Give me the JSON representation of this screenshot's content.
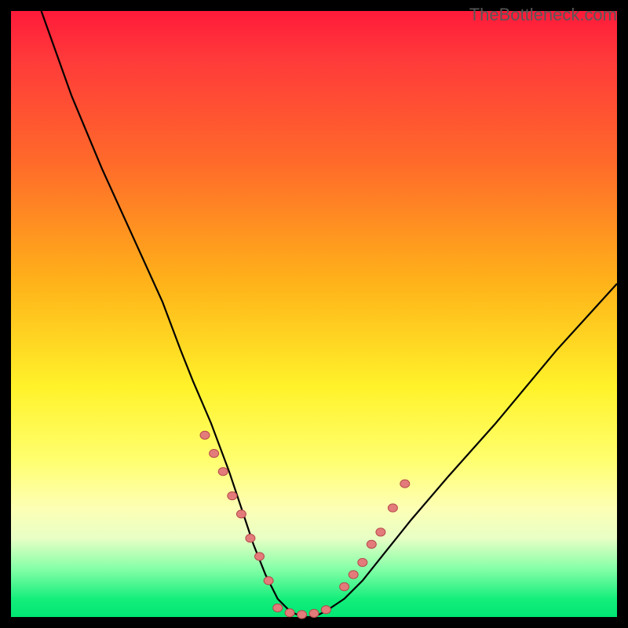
{
  "watermark": "TheBottleneck.com",
  "chart_data": {
    "type": "line",
    "title": "",
    "xlabel": "",
    "ylabel": "",
    "xlim": [
      0,
      100
    ],
    "ylim": [
      0,
      100
    ],
    "grid": false,
    "legend": false,
    "notes": "V-shaped bottleneck curve overlaid on a red→green vertical gradient. Curve minimum (best/no bottleneck) at x≈48, y≈0. Left arm rises to y≈100 near x≈5; right arm rises to y≈55 at x≈100. Pink bead-like markers cluster on both arms near y≈12–30 and along the flat bottom.",
    "series": [
      {
        "name": "bottleneck-curve",
        "x": [
          5,
          10,
          15,
          20,
          25,
          28,
          30,
          33,
          36,
          38,
          40,
          42,
          44,
          46,
          48,
          50,
          52,
          55,
          58,
          62,
          66,
          72,
          80,
          90,
          100
        ],
        "y": [
          100,
          86,
          74,
          63,
          52,
          44,
          39,
          32,
          24,
          18,
          12,
          7,
          3,
          1,
          0,
          0,
          1,
          3,
          6,
          11,
          16,
          23,
          32,
          44,
          55
        ]
      }
    ],
    "markers": [
      {
        "name": "left-arm-beads",
        "x": [
          32,
          33.5,
          35,
          36.5,
          38,
          39.5,
          41,
          42.5
        ],
        "y": [
          30,
          27,
          24,
          20,
          17,
          13,
          10,
          6
        ]
      },
      {
        "name": "bottom-beads",
        "x": [
          44,
          46,
          48,
          50,
          52
        ],
        "y": [
          1.5,
          0.7,
          0.4,
          0.6,
          1.2
        ]
      },
      {
        "name": "right-arm-beads",
        "x": [
          55,
          56.5,
          58,
          59.5,
          61,
          63,
          65
        ],
        "y": [
          5,
          7,
          9,
          12,
          14,
          18,
          22
        ]
      }
    ],
    "gradient_stops": [
      {
        "pos": 0,
        "color": "#ff1a3a"
      },
      {
        "pos": 8,
        "color": "#ff3a3a"
      },
      {
        "pos": 25,
        "color": "#ff6a2a"
      },
      {
        "pos": 45,
        "color": "#ffb319"
      },
      {
        "pos": 62,
        "color": "#fff22a"
      },
      {
        "pos": 74,
        "color": "#ffff6e"
      },
      {
        "pos": 82,
        "color": "#fdffb4"
      },
      {
        "pos": 87,
        "color": "#e8ffc5"
      },
      {
        "pos": 92,
        "color": "#86ffa8"
      },
      {
        "pos": 97,
        "color": "#15ee7b"
      },
      {
        "pos": 100,
        "color": "#00e673"
      }
    ],
    "marker_style": {
      "fill": "#e37b7b",
      "stroke": "#b54a4a",
      "r": 6
    }
  }
}
